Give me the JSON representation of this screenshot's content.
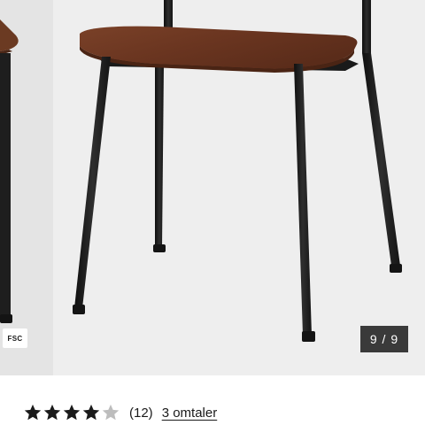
{
  "gallery": {
    "badge": "FSC",
    "counter": "9 / 9",
    "image_subject": "chair-with-walnut-seat-and-black-metal-legs"
  },
  "rating": {
    "value": 4,
    "max": 5,
    "count": "(12)",
    "reviews_link": "3 omtaler"
  },
  "colors": {
    "wood": "#6b3a22",
    "metal": "#1e1e1e",
    "background": "#eeeeee",
    "star_filled": "#1a1a1a",
    "star_empty": "#bdbdbd"
  }
}
